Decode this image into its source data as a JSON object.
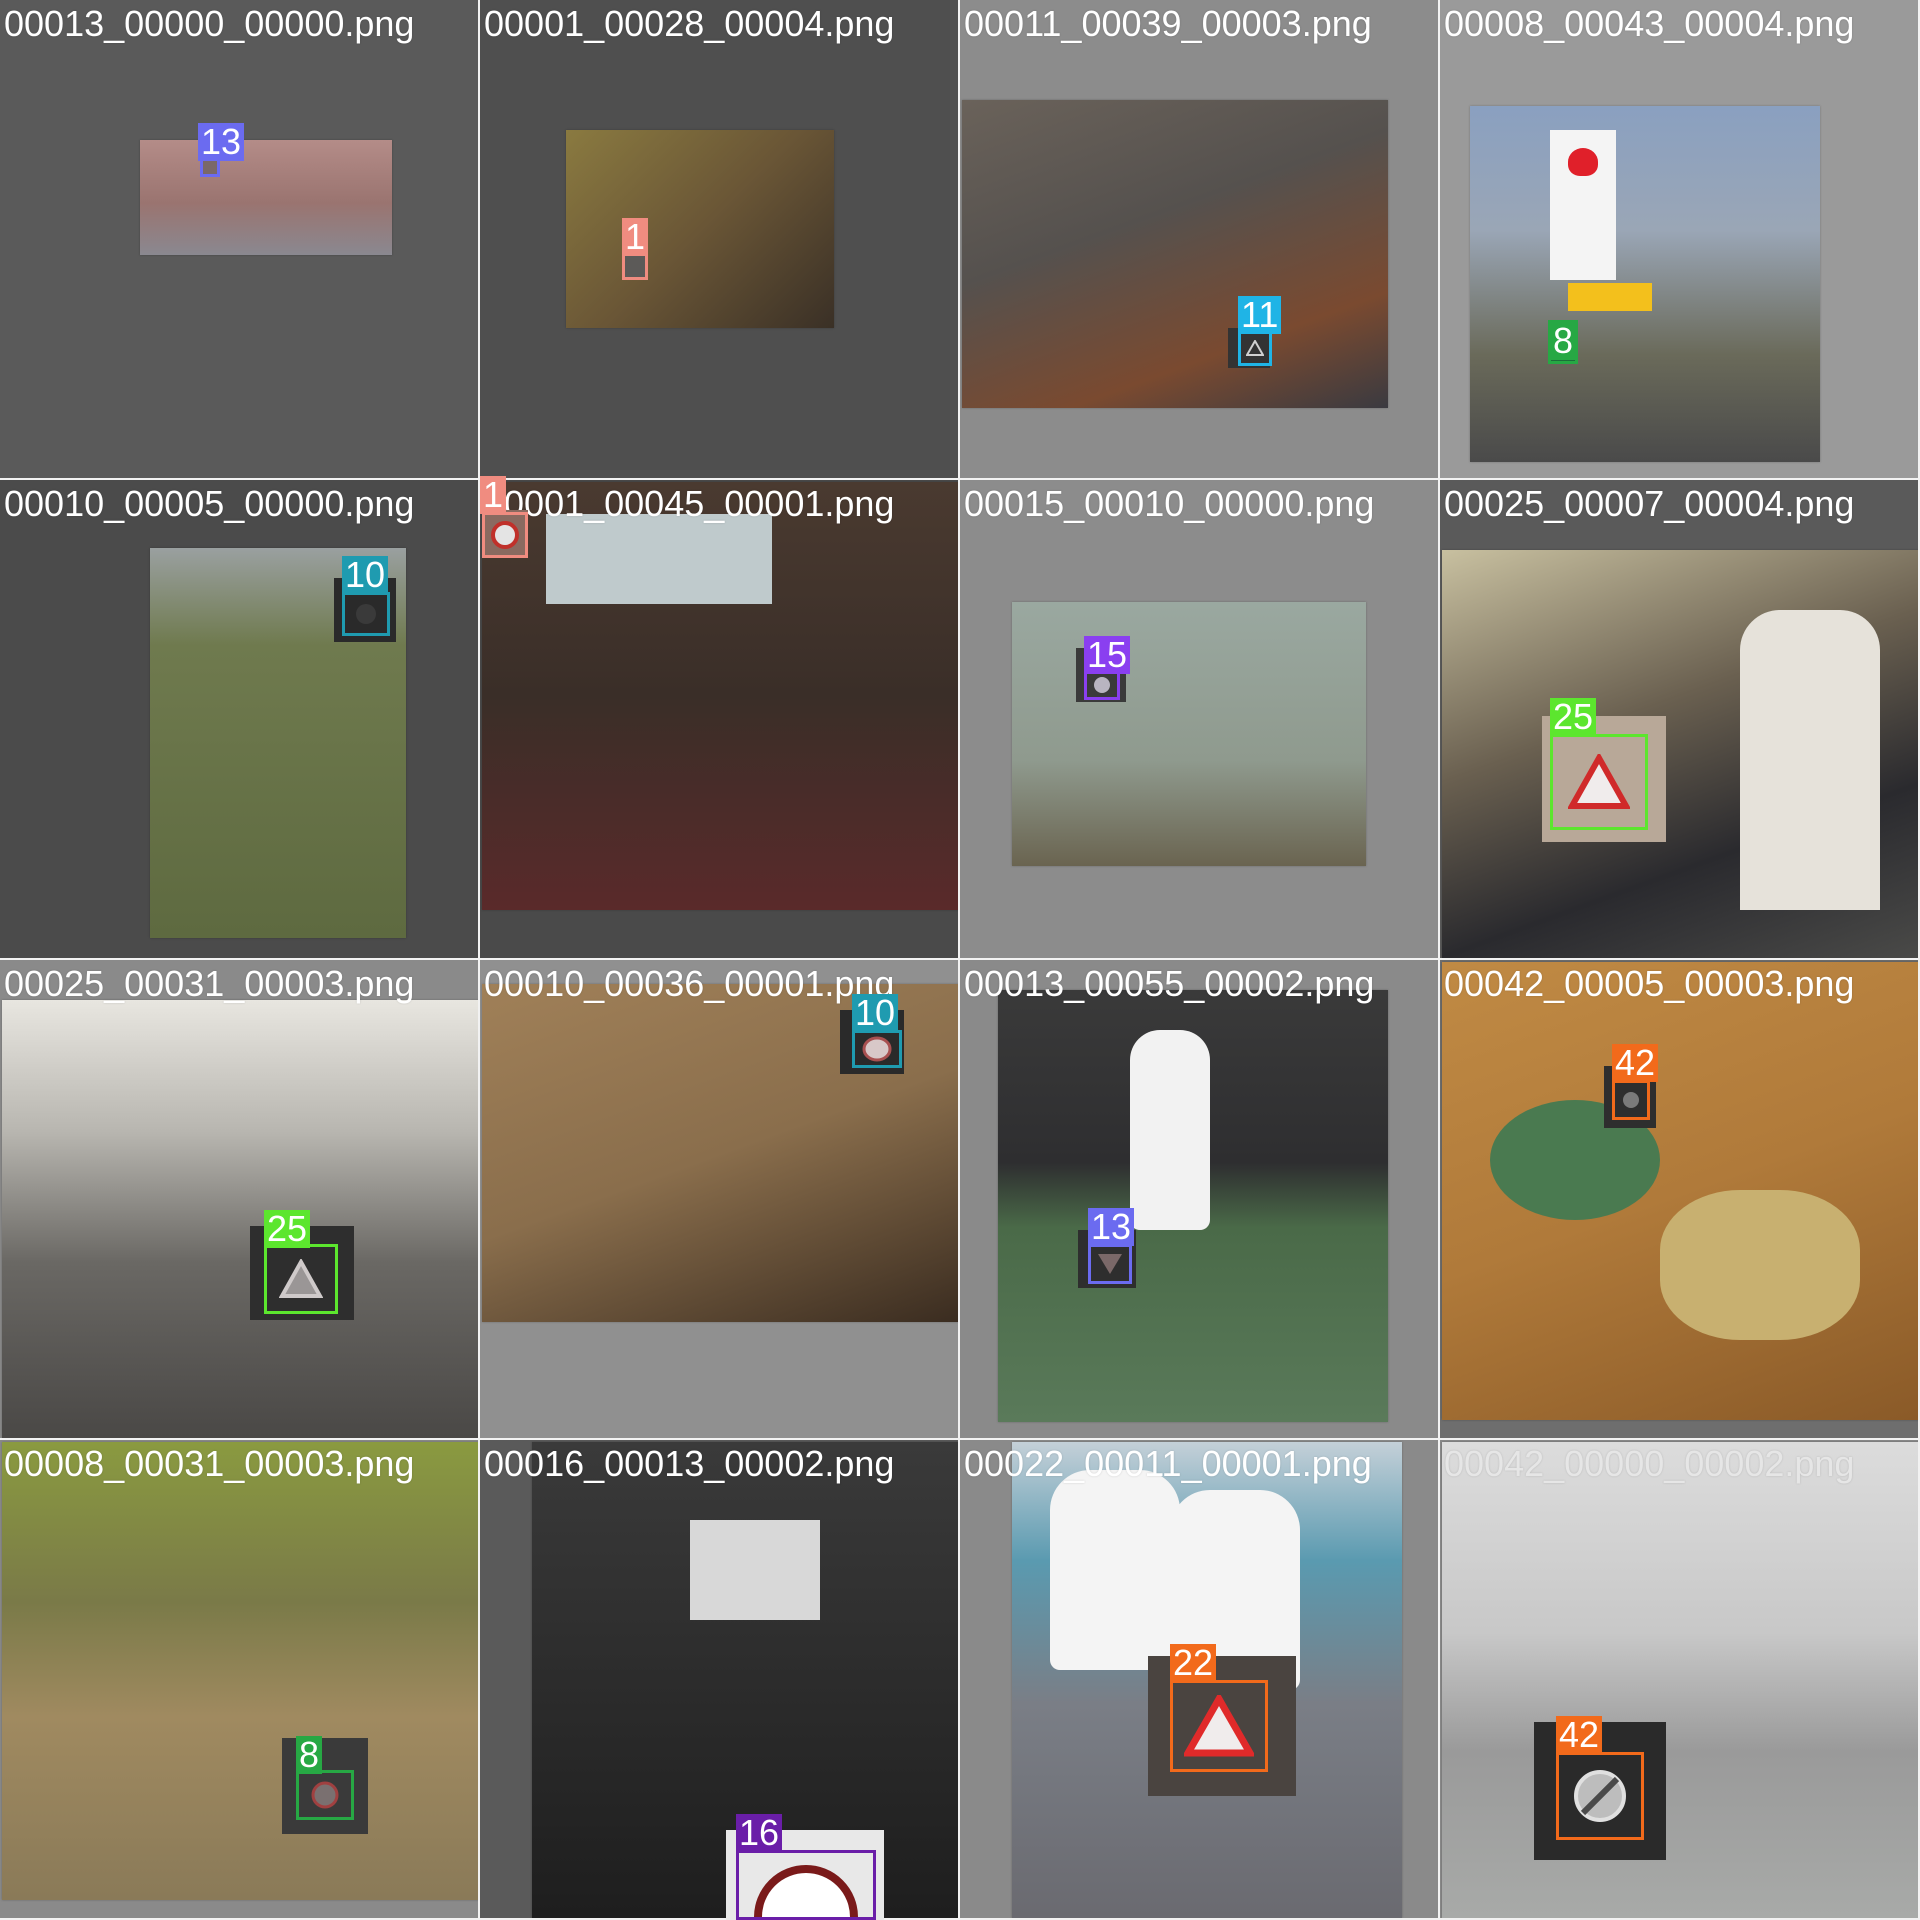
{
  "tiles": [
    {
      "filename": "00013_00000_00000.png",
      "label": "13",
      "label_color": "#6b6bf0",
      "bg": "#5a5a5a",
      "photo": "#a07a78",
      "icon": "round-sign-icon"
    },
    {
      "filename": "00001_00028_00004.png",
      "label": "1",
      "label_color": "#f08c80",
      "bg": "#4f4f4f",
      "photo": "#6d5a3a",
      "icon": "round-sign-icon"
    },
    {
      "filename": "00011_00039_00003.png",
      "label": "11",
      "label_color": "#1fb4e6",
      "bg": "#8c8c8c",
      "photo": "#5e5752",
      "icon": "triangle-sign-icon"
    },
    {
      "filename": "00008_00043_00004.png",
      "label": "8",
      "label_color": "#27a844",
      "bg": "#9a9a9a",
      "photo": "#8e98a6",
      "icon": "round-sign-icon"
    },
    {
      "filename": "00010_00005_00000.png",
      "label": "10",
      "label_color": "#1f9bb0",
      "bg": "#4b4b4b",
      "photo": "#6c7450",
      "icon": "round-sign-icon"
    },
    {
      "filename": "00001_00045_00001.png",
      "label": "1",
      "label_color": "#f08c80",
      "bg": "#4a4a4a",
      "photo": "#3a2e28",
      "icon": "round-sign-icon"
    },
    {
      "filename": "00015_00010_00000.png",
      "label": "15",
      "label_color": "#8a3ff0",
      "bg": "#8c8c8c",
      "photo": "#8f9a8e",
      "icon": "round-sign-icon"
    },
    {
      "filename": "00025_00007_00004.png",
      "label": "25",
      "label_color": "#5ce62e",
      "bg": "#5a5a5a",
      "photo": "#5e5548",
      "icon": "triangle-sign-icon"
    },
    {
      "filename": "00025_00031_00003.png",
      "label": "25",
      "label_color": "#5ce62e",
      "bg": "#8a8a8a",
      "photo": "#8a8680",
      "icon": "triangle-sign-icon"
    },
    {
      "filename": "00010_00036_00001.png",
      "label": "10",
      "label_color": "#1f9bb0",
      "bg": "#909090",
      "photo": "#8a6e4c",
      "icon": "round-sign-icon"
    },
    {
      "filename": "00013_00055_00002.png",
      "label": "13",
      "label_color": "#6b6bf0",
      "bg": "#8a8a8a",
      "photo": "#4a5a48",
      "icon": "triangle-sign-icon"
    },
    {
      "filename": "00042_00005_00003.png",
      "label": "42",
      "label_color": "#f26a1b",
      "bg": "#6e6e6e",
      "photo": "#b07a3a",
      "icon": "round-sign-icon"
    },
    {
      "filename": "00008_00031_00003.png",
      "label": "8",
      "label_color": "#27a844",
      "bg": "#8a8a8a",
      "photo": "#8a7a50",
      "icon": "round-sign-icon"
    },
    {
      "filename": "00016_00013_00002.png",
      "label": "16",
      "label_color": "#6a1ea8",
      "bg": "#5a5a5a",
      "photo": "#3c3c3c",
      "icon": "round-sign-icon"
    },
    {
      "filename": "00022_00011_00001.png",
      "label": "22",
      "label_color": "#f26a1b",
      "bg": "#8a8a8a",
      "photo": "#7a7e86",
      "icon": "triangle-sign-icon"
    },
    {
      "filename": "00042_00000_00002.png",
      "label": "42",
      "label_color": "#f26a1b",
      "bg": "#8a8a8a",
      "photo": "#a8aaa8",
      "icon": "round-sign-icon"
    }
  ]
}
